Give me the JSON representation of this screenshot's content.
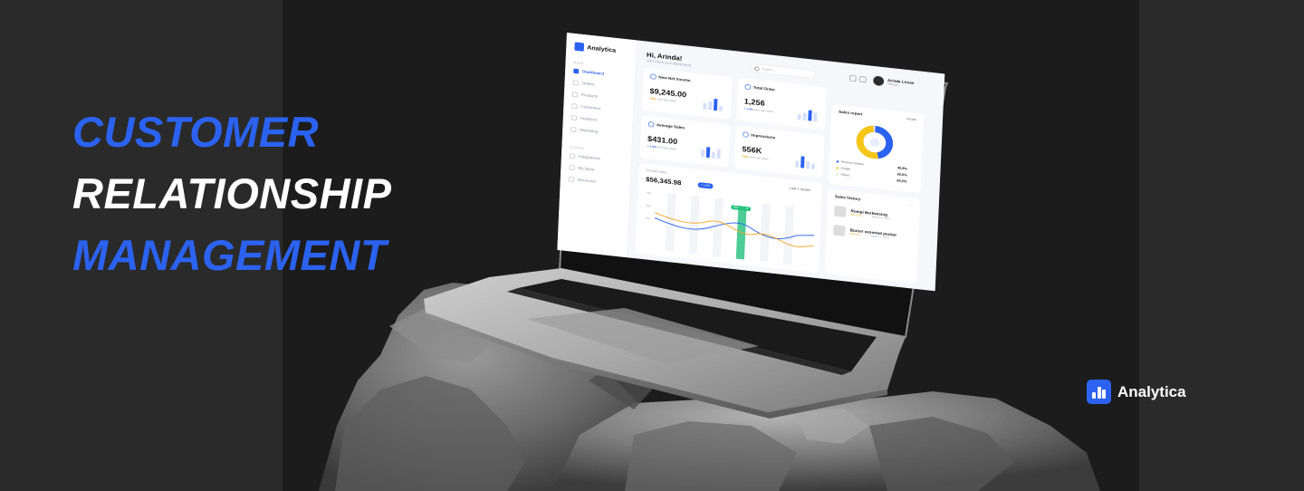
{
  "headline": {
    "line1": "CUSTOMER",
    "line2": "RELATIONSHIP",
    "line3": "MANAGEMENT"
  },
  "brand": {
    "name": "Analytica",
    "color": "#2b62f0"
  },
  "dashboard": {
    "logo": "Analytica",
    "greeting": "Hi, Arinda!",
    "greeting_sub": "Let's check your dashboards",
    "search_placeholder": "Search...",
    "user": {
      "name": "Arinda Lirose",
      "role": "Manager"
    },
    "sidebar": {
      "menu_section": "MENU",
      "items": [
        "Dashboard",
        "Orders",
        "Products",
        "Customers",
        "Analytics",
        "Marketing"
      ],
      "others_section": "OTHERS",
      "other_items": [
        "Integrations",
        "My Store",
        "Discounts"
      ]
    },
    "cards": [
      {
        "title": "New Net Income",
        "value": "$9,245.00",
        "change": "-50%",
        "change_sub": "from last week",
        "trend": "down"
      },
      {
        "title": "Total Order",
        "value": "1,256",
        "change": "+ 1.6%",
        "change_sub": "from last week",
        "trend": "up"
      },
      {
        "title": "Average Sales",
        "value": "$431.00",
        "change": "+ 1.6%",
        "change_sub": "from last week",
        "trend": "up"
      },
      {
        "title": "Impressions",
        "value": "556K",
        "change": "-50%",
        "change_sub": "from last week",
        "trend": "down"
      }
    ],
    "sales_report": {
      "title": "Sales report",
      "period": "Month",
      "legend": [
        {
          "label": "Personal website",
          "value": "45,8%",
          "color": "#2b62f0"
        },
        {
          "label": "Google",
          "value": "25,0%",
          "color": "#f5c518"
        },
        {
          "label": "Others",
          "value": "29,2%",
          "color": "#e0e3ea"
        }
      ]
    },
    "overall_sales": {
      "label": "Overall sales",
      "value": "$56,345.98",
      "badge": "+ 1.6%",
      "period": "Last 1 month",
      "y_ticks": [
        "40k",
        "30k",
        "20k"
      ],
      "tooltip": "$56,345.98"
    },
    "sales_history": {
      "title": "Sales history",
      "items": [
        {
          "name": "Rompi Berkancing",
          "price": "$110.00",
          "date": "April 24, 2022"
        },
        {
          "name": "Buzzer assorted pocket",
          "price": "$110.00",
          "date": "April 24, 2022"
        }
      ]
    }
  }
}
